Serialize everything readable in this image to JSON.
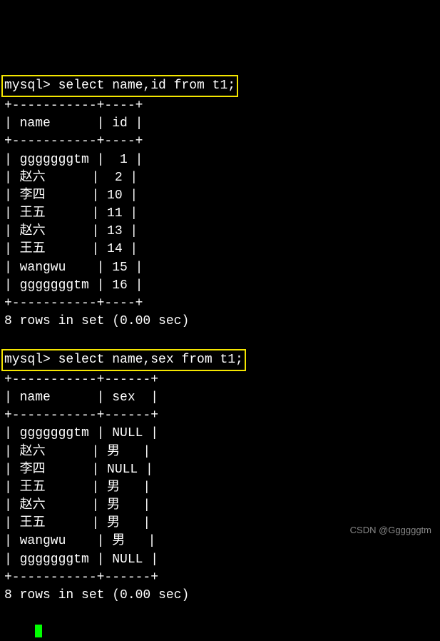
{
  "query1": {
    "prompt": "mysql> select name,id from t1;",
    "columns": [
      "name",
      "id"
    ],
    "sep_top": "+----------+----+",
    "sep": "+----------+----+",
    "rows": [
      {
        "name": "gggggggtm",
        "id": "1"
      },
      {
        "name": "赵六",
        "id": "2"
      },
      {
        "name": "李四",
        "id": "10"
      },
      {
        "name": "王五",
        "id": "11"
      },
      {
        "name": "赵六",
        "id": "13"
      },
      {
        "name": "王五",
        "id": "14"
      },
      {
        "name": "wangwu",
        "id": "15"
      },
      {
        "name": "gggggggtm",
        "id": "16"
      }
    ],
    "footer": "8 rows in set (0.00 sec)"
  },
  "query2": {
    "prompt": "mysql> select name,sex from t1;",
    "columns": [
      "name",
      "sex"
    ],
    "rows": [
      {
        "name": "gggggggtm",
        "sex": "NULL"
      },
      {
        "name": "赵六",
        "sex": "男"
      },
      {
        "name": "李四",
        "sex": "NULL"
      },
      {
        "name": "王五",
        "sex": "男"
      },
      {
        "name": "赵六",
        "sex": "男"
      },
      {
        "name": "王五",
        "sex": "男"
      },
      {
        "name": "wangwu",
        "sex": "男"
      },
      {
        "name": "gggggggtm",
        "sex": "NULL"
      }
    ],
    "footer": "8 rows in set (0.00 sec)"
  },
  "watermark": "CSDN @Ggggggtm"
}
